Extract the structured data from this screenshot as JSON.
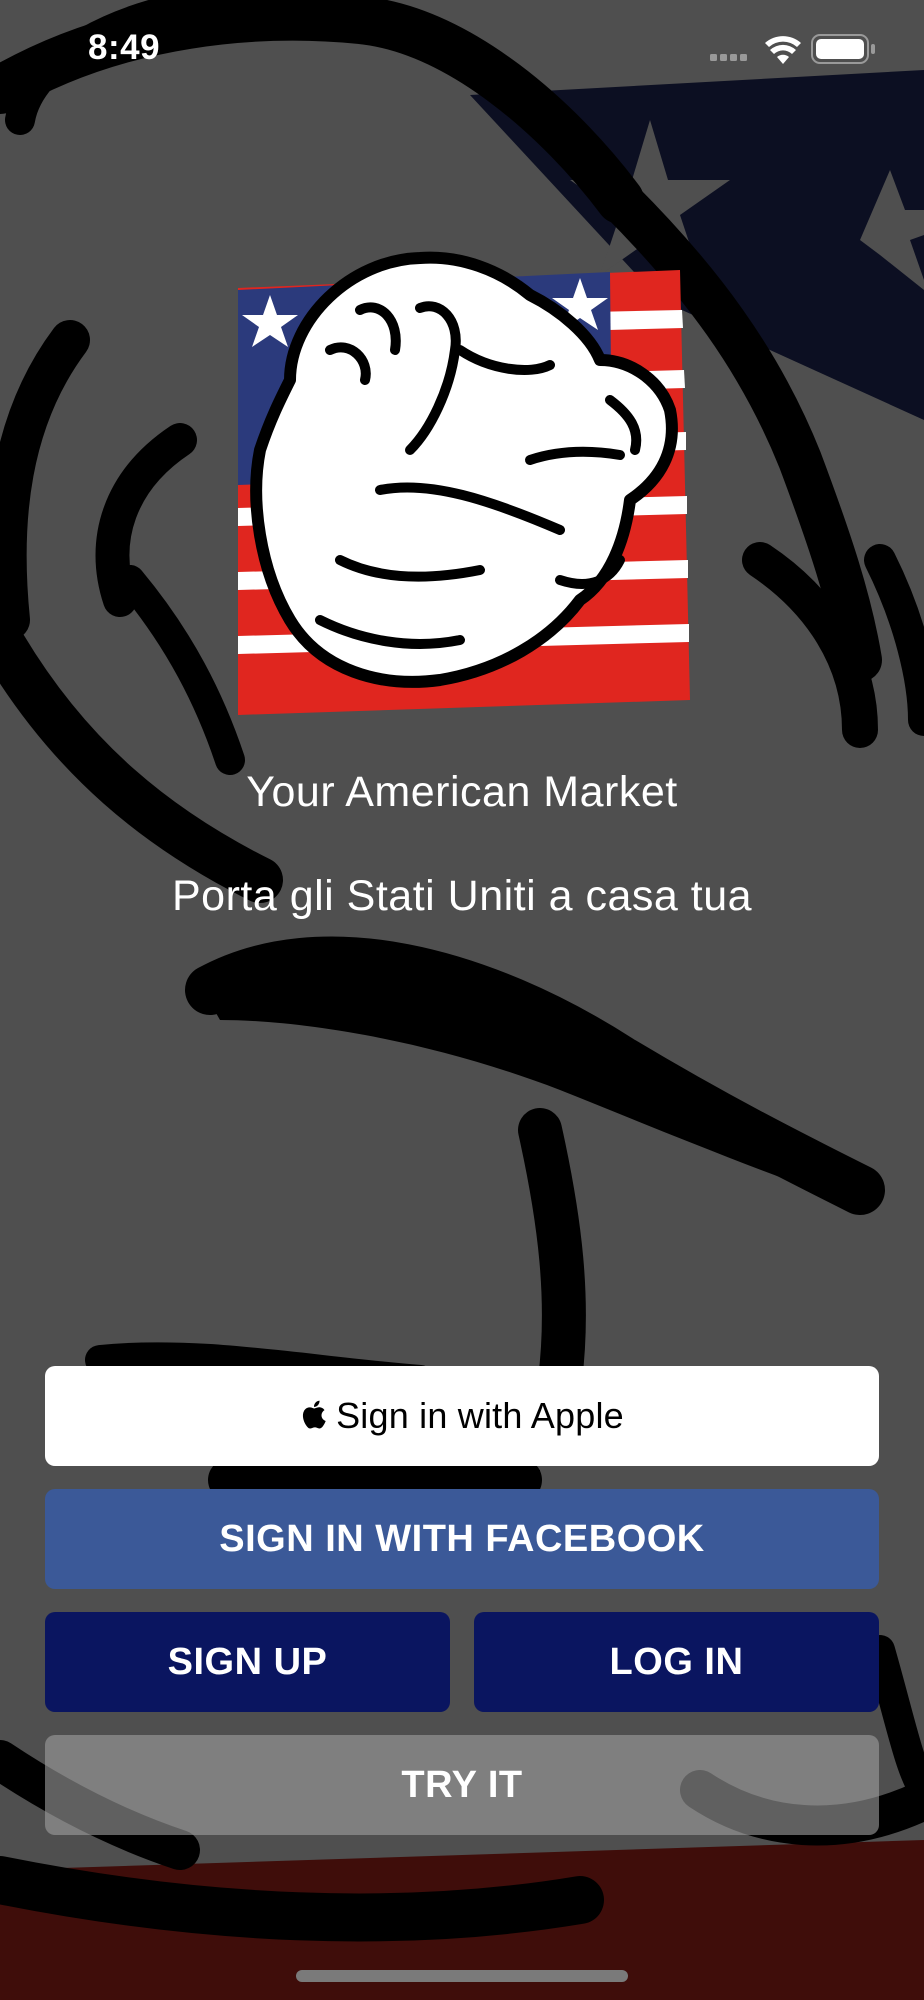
{
  "status_bar": {
    "time": "8:49",
    "icons": [
      "cellular-signal-icon",
      "wifi-icon",
      "battery-icon"
    ]
  },
  "app": {
    "tagline": "Your American Market",
    "subtitle": "Porta gli Stati Uniti a casa tua"
  },
  "buttons": {
    "apple": "Sign in with Apple",
    "facebook": "SIGN IN WITH FACEBOOK",
    "signup": "SIGN UP",
    "login": "LOG IN",
    "try": "TRY IT"
  },
  "colors": {
    "background": "#505050",
    "facebook": "#3b5998",
    "primary_navy": "#0a1560",
    "flag_red": "#e0261f",
    "flag_blue": "#2b3a7c"
  }
}
